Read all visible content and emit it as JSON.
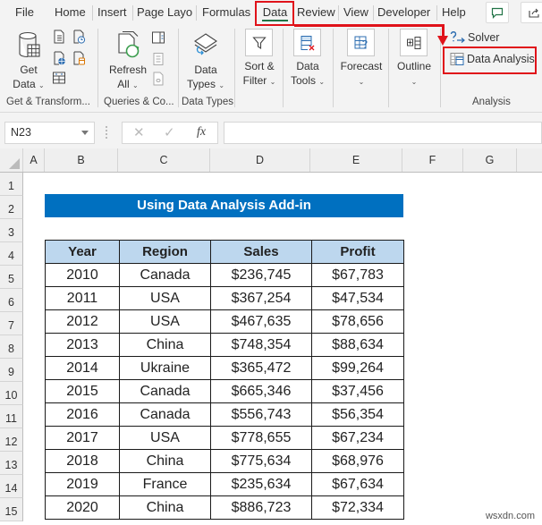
{
  "tabs": [
    {
      "label": "File"
    },
    {
      "label": "Home"
    },
    {
      "label": "Insert"
    },
    {
      "label": "Page Layout"
    },
    {
      "label": "Formulas"
    },
    {
      "label": "Data",
      "active": true
    },
    {
      "label": "Review"
    },
    {
      "label": "View"
    },
    {
      "label": "Developer"
    },
    {
      "label": "Help"
    }
  ],
  "tab_labels": {
    "file": "File",
    "home": "Home",
    "insert": "Insert",
    "page_layout": "Page Layo",
    "formulas": "Formulas",
    "data": "Data",
    "review": "Review",
    "view": "View",
    "developer": "Developer",
    "help": "Help"
  },
  "ribbon": {
    "get_transform": {
      "get_data_line1": "Get",
      "get_data_line2": "Data",
      "group_label": "Get & Transform..."
    },
    "queries": {
      "refresh_line1": "Refresh",
      "refresh_line2": "All",
      "group_label": "Queries & Co..."
    },
    "data_types": {
      "line1": "Data",
      "line2": "Types",
      "group_label": "Data Types"
    },
    "sort_filter": {
      "line1": "Sort &",
      "line2": "Filter"
    },
    "data_tools": {
      "line1": "Data",
      "line2": "Tools"
    },
    "forecast": {
      "line1": "Forecast"
    },
    "outline": {
      "line1": "Outline"
    },
    "analysis": {
      "solver": "Solver",
      "data_analysis": "Data Analysis",
      "group_label": "Analysis"
    }
  },
  "formula_bar": {
    "name_box": "N23",
    "formula": ""
  },
  "columns": [
    "A",
    "B",
    "C",
    "D",
    "E",
    "F",
    "G"
  ],
  "rows": [
    "1",
    "2",
    "3",
    "4",
    "5",
    "6",
    "7",
    "8",
    "9",
    "10",
    "11",
    "12",
    "13",
    "14",
    "15"
  ],
  "sheet": {
    "title": "Using Data Analysis Add-in",
    "headers": [
      "Year",
      "Region",
      "Sales",
      "Profit"
    ],
    "records": [
      [
        "2010",
        "Canada",
        "$236,745",
        "$67,783"
      ],
      [
        "2011",
        "USA",
        "$367,254",
        "$47,534"
      ],
      [
        "2012",
        "USA",
        "$467,635",
        "$78,656"
      ],
      [
        "2013",
        "China",
        "$748,354",
        "$88,634"
      ],
      [
        "2014",
        "Ukraine",
        "$365,472",
        "$99,264"
      ],
      [
        "2015",
        "Canada",
        "$665,346",
        "$37,456"
      ],
      [
        "2016",
        "Canada",
        "$556,743",
        "$56,354"
      ],
      [
        "2017",
        "USA",
        "$778,655",
        "$67,234"
      ],
      [
        "2018",
        "China",
        "$775,634",
        "$68,976"
      ],
      [
        "2019",
        "France",
        "$235,634",
        "$67,634"
      ],
      [
        "2020",
        "China",
        "$886,723",
        "$72,334"
      ]
    ]
  },
  "watermark": "wsxdn.com",
  "colors": {
    "title_banner": "#0070c0",
    "header_fill": "#bdd7ee",
    "highlight": "#e0121a",
    "excel_green": "#217346"
  }
}
